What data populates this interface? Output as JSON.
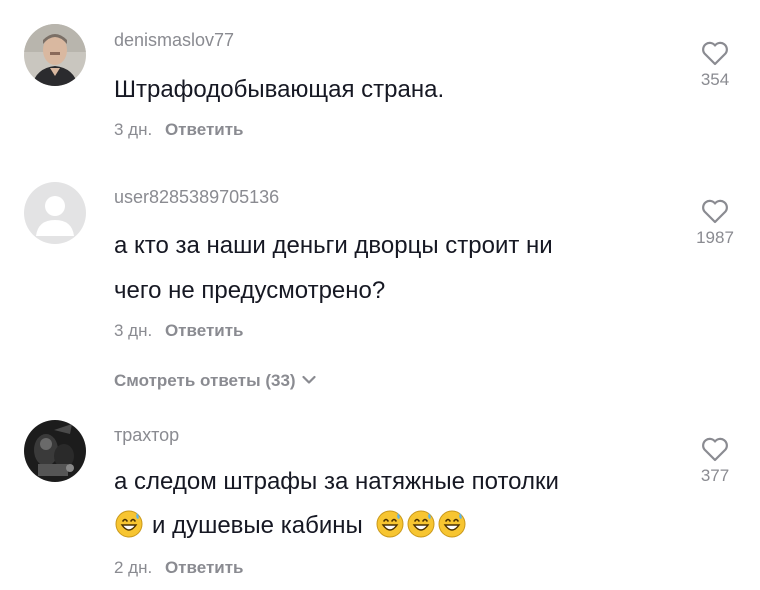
{
  "comments": [
    {
      "username": "denismaslov77",
      "text": "Штрафодобывающая страна.",
      "time": "3 дн.",
      "reply_label": "Ответить",
      "likes": "354"
    },
    {
      "username": "user8285389705136",
      "text_line1": "а кто за наши деньги дворцы строит ни",
      "text_line2": "чего не предусмотрено?",
      "time": "3 дн.",
      "reply_label": "Ответить",
      "likes": "1987",
      "view_replies": "Смотреть ответы (33)"
    },
    {
      "username": "трахтор",
      "text_line1": "а следом штрафы за натяжные потолки",
      "text_line2": "и душевые кабины",
      "time": "2 дн.",
      "reply_label": "Ответить",
      "likes": "377"
    }
  ],
  "icons": {
    "like": "heart-outline-icon",
    "expand": "chevron-down-icon",
    "emoji": "grinning-sweat-emoji"
  },
  "colors": {
    "primary_text": "#161823",
    "secondary_text": "#8a8b91",
    "emoji_face": "#f7c531",
    "emoji_sweat": "#5ab2ea"
  }
}
